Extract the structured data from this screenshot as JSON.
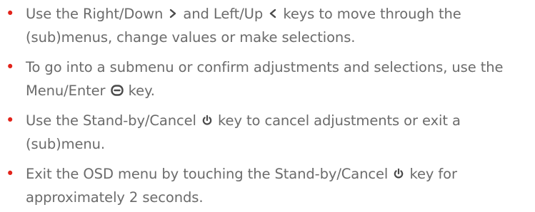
{
  "instructions": {
    "bullet_char": "•",
    "accent_color": "#e2231a",
    "text_color": "#6b6b6b",
    "items": [
      {
        "seg1": "Use the Right/Down",
        "icon1": "chevron-right-icon",
        "seg2": "and Left/Up",
        "icon2": "chevron-left-icon",
        "seg3": "keys to move through the (sub)menus, change values or make selections."
      },
      {
        "seg1": "To go into a submenu or confirm adjustments and selections, use the Menu/Enter",
        "icon1": "menu-enter-icon",
        "seg2": "key."
      },
      {
        "seg1": "Use the Stand-by/Cancel",
        "icon1": "power-icon",
        "seg2": "key to cancel adjustments or exit a (sub)menu."
      },
      {
        "seg1": "Exit the OSD menu by touching the Stand-by/Cancel",
        "icon1": "power-icon",
        "seg2": "key for approximately 2 seconds."
      }
    ]
  }
}
